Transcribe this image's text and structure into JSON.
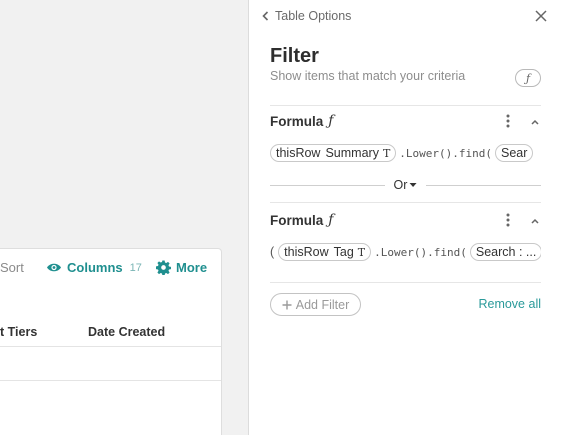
{
  "table": {
    "toolbar": {
      "sort_label": "Sort",
      "columns_label": "Columns",
      "columns_count": "17",
      "more_label": "More"
    },
    "headers": [
      "t Tiers",
      "Date Created"
    ]
  },
  "panel": {
    "breadcrumb": "Table Options",
    "title": "Filter",
    "subtitle": "Show items that match your criteria",
    "fx_badge": "ƒ",
    "filters": [
      {
        "label": "Formula",
        "fx": "ƒ",
        "prefix": "",
        "row_token": "thisRow",
        "column_token": "Summary",
        "type_token": "T",
        "call": ".Lower().find(",
        "arg_token": "Sear"
      },
      {
        "label": "Formula",
        "fx": "ƒ",
        "prefix": "(",
        "row_token": "thisRow",
        "column_token": "Tag",
        "type_token": "T",
        "call": ".Lower().find(",
        "arg_token": "Search : ..."
      }
    ],
    "or_label": "Or",
    "add_filter_label": "Add Filter",
    "remove_all_label": "Remove all"
  },
  "colors": {
    "accent": "#1f8f8f",
    "link": "#2a9a9a"
  }
}
